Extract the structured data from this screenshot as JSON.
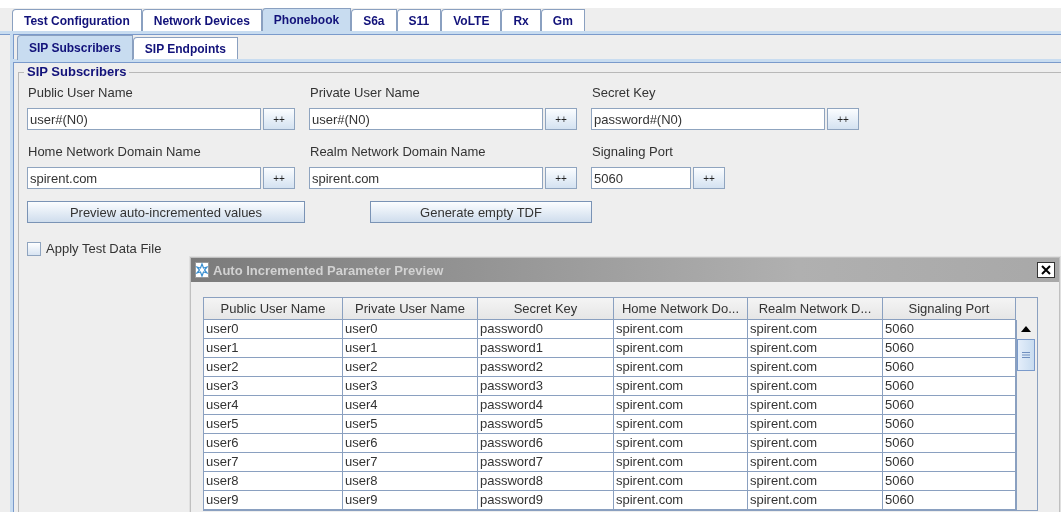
{
  "tabs": [
    {
      "label": "Test Configuration",
      "selected": false
    },
    {
      "label": "Network Devices",
      "selected": false
    },
    {
      "label": "Phonebook",
      "selected": true
    },
    {
      "label": "S6a",
      "selected": false
    },
    {
      "label": "S11",
      "selected": false
    },
    {
      "label": "VoLTE",
      "selected": false
    },
    {
      "label": "Rx",
      "selected": false
    },
    {
      "label": "Gm",
      "selected": false
    }
  ],
  "subtabs": [
    {
      "label": "SIP Subscribers",
      "selected": true
    },
    {
      "label": "SIP Endpoints",
      "selected": false
    }
  ],
  "group": {
    "title": "SIP Subscribers",
    "field_rows": [
      [
        {
          "label": "Public User Name",
          "value": "user#(N0)",
          "button": "++",
          "kind": "wide"
        },
        {
          "label": "Private User Name",
          "value": "user#(N0)",
          "button": "++",
          "kind": "wide"
        },
        {
          "label": "Secret Key",
          "value": "password#(N0)",
          "button": "++",
          "kind": "wide"
        }
      ],
      [
        {
          "label": "Home Network Domain Name",
          "value": "spirent.com",
          "button": "++",
          "kind": "wide"
        },
        {
          "label": "Realm Network Domain Name",
          "value": "spirent.com",
          "button": "++",
          "kind": "wide"
        },
        {
          "label": "Signaling Port",
          "value": "5060",
          "button": "++",
          "kind": "narrow"
        }
      ]
    ],
    "buttons": [
      "Preview auto-incremented values",
      "Generate empty TDF"
    ],
    "checkbox": {
      "label": "Apply Test Data File",
      "checked": false
    }
  },
  "dialog": {
    "title": "Auto Incremented Parameter Preview",
    "columns": [
      "Public User Name",
      "Private User Name",
      "Secret Key",
      "Home Network Do...",
      "Realm Network D...",
      "Signaling Port"
    ],
    "rows": [
      [
        "user0",
        "user0",
        "password0",
        "spirent.com",
        "spirent.com",
        "5060"
      ],
      [
        "user1",
        "user1",
        "password1",
        "spirent.com",
        "spirent.com",
        "5060"
      ],
      [
        "user2",
        "user2",
        "password2",
        "spirent.com",
        "spirent.com",
        "5060"
      ],
      [
        "user3",
        "user3",
        "password3",
        "spirent.com",
        "spirent.com",
        "5060"
      ],
      [
        "user4",
        "user4",
        "password4",
        "spirent.com",
        "spirent.com",
        "5060"
      ],
      [
        "user5",
        "user5",
        "password5",
        "spirent.com",
        "spirent.com",
        "5060"
      ],
      [
        "user6",
        "user6",
        "password6",
        "spirent.com",
        "spirent.com",
        "5060"
      ],
      [
        "user7",
        "user7",
        "password7",
        "spirent.com",
        "spirent.com",
        "5060"
      ],
      [
        "user8",
        "user8",
        "password8",
        "spirent.com",
        "spirent.com",
        "5060"
      ],
      [
        "user9",
        "user9",
        "password9",
        "spirent.com",
        "spirent.com",
        "5060"
      ]
    ]
  }
}
